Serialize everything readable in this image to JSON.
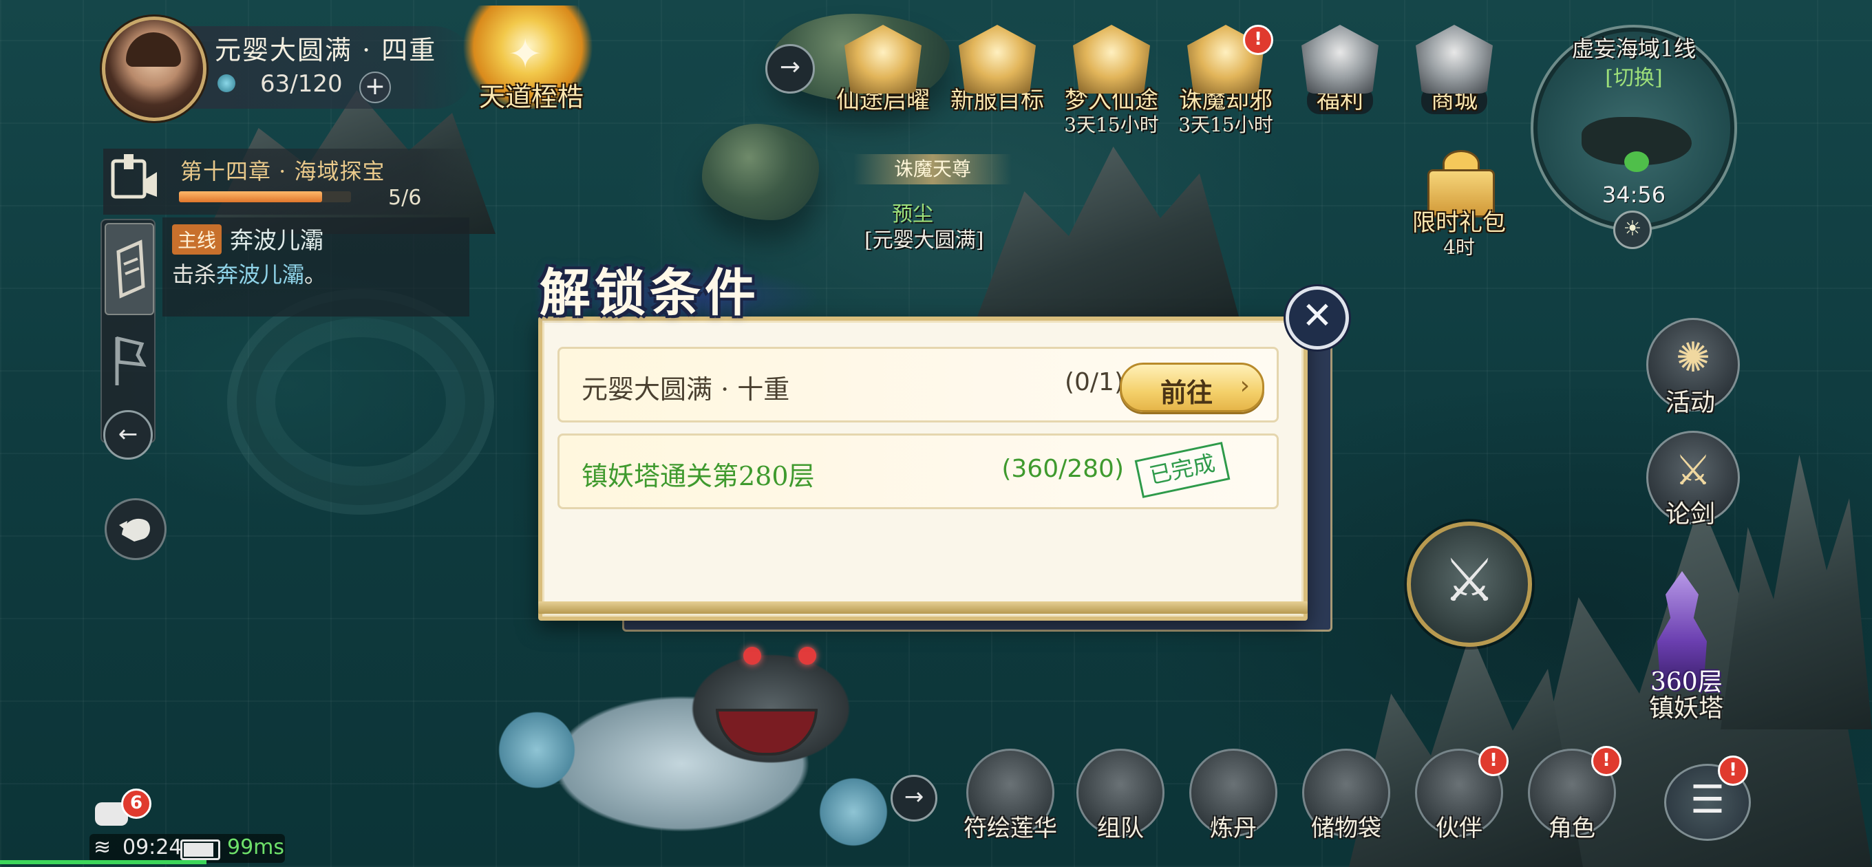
{
  "player": {
    "realm": "元婴大圆满 · 四重",
    "energy": "63/120",
    "plus": "+"
  },
  "tiandao": {
    "label": "天道桎梏"
  },
  "quest": {
    "chapter": "第十四章 · 海域探宝",
    "progress_text": "5/6",
    "progress_fraction": 0.833,
    "tag": "主线",
    "target": "奔波儿灞",
    "desc_prefix": "击杀",
    "desc_target": "奔波儿灞",
    "desc_suffix": "。"
  },
  "features": [
    {
      "label": "仙途启曜",
      "sub": "",
      "icon": "crest-icon",
      "badge": false
    },
    {
      "label": "新服目标",
      "sub": "",
      "icon": "banner-icon",
      "badge": false
    },
    {
      "label": "梦入仙途",
      "sub": "3天15小时",
      "icon": "cloud-icon",
      "badge": false
    },
    {
      "label": "诛魔却邪",
      "sub": "3天15小时",
      "icon": "demon-icon",
      "badge": true
    },
    {
      "label": "福利",
      "sub": "",
      "icon": "gift-icon",
      "badge": false
    },
    {
      "label": "商城",
      "sub": "",
      "icon": "shop-icon",
      "badge": false
    }
  ],
  "minimap": {
    "name": "虚妄海域1线",
    "switch": "[切换]",
    "time": "34:56"
  },
  "npc": {
    "banner": "诛魔天尊",
    "name": "预尘",
    "realm": "[元婴大圆满]"
  },
  "gift": {
    "label": "限时礼包",
    "sub": "4时"
  },
  "right_buttons": {
    "activity": "活动",
    "duel": "论剑",
    "tower_level": "360层",
    "tower": "镇妖塔"
  },
  "bottom_nav": [
    {
      "label": "符绘莲华",
      "icon": "talisman-icon",
      "badge": false
    },
    {
      "label": "组队",
      "icon": "team-icon",
      "badge": false
    },
    {
      "label": "炼丹",
      "icon": "cauldron-icon",
      "badge": false
    },
    {
      "label": "储物袋",
      "icon": "bag-icon",
      "badge": false
    },
    {
      "label": "伙伴",
      "icon": "partner-icon",
      "badge": true
    },
    {
      "label": "角色",
      "icon": "character-icon",
      "badge": true
    }
  ],
  "chat": {
    "count": "6"
  },
  "status": {
    "time": "09:24",
    "ping": "99ms",
    "battery_fraction": 0.9
  },
  "modal": {
    "title": "解锁条件",
    "conditions": [
      {
        "name": "元婴大圆满 · 十重",
        "count": "(0/1)",
        "action": "前往",
        "done": false
      },
      {
        "name": "镇妖塔通关第280层",
        "count": "(360/280)",
        "action": "已完成",
        "done": true
      }
    ]
  },
  "colors": {
    "accent_gold": "#f4d06a",
    "done_green": "#3f9a2e",
    "badge_red": "#e03a2e",
    "sea": "#0f3b3f"
  }
}
